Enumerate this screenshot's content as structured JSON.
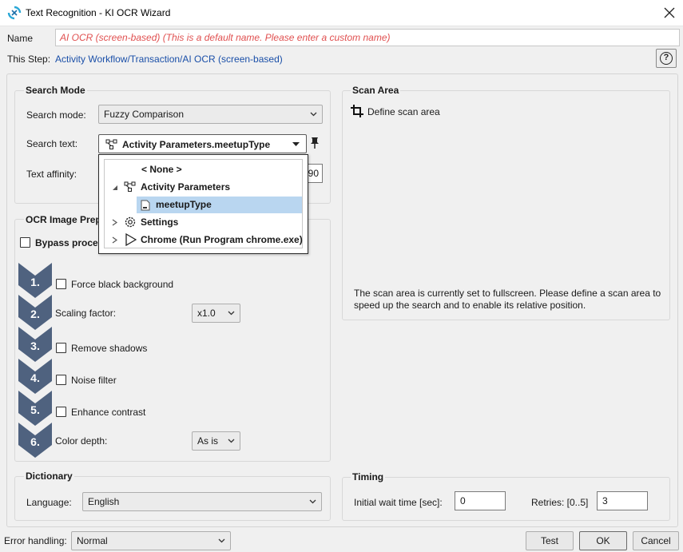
{
  "window": {
    "title": "Text Recognition - KI OCR Wizard"
  },
  "name_row": {
    "label": "Name",
    "placeholder": "AI OCR (screen-based)  (This is a default name. Please enter a custom name)"
  },
  "step_row": {
    "label": "This Step:",
    "path": "Activity Workflow/Transaction/AI OCR (screen-based)",
    "help_label": "?"
  },
  "search_mode": {
    "title": "Search Mode",
    "mode_label": "Search mode:",
    "mode_value": "Fuzzy Comparison",
    "text_label": "Search text:",
    "text_value": "Activity Parameters.meetupType",
    "affinity_label": "Text affinity:",
    "affinity_value": "90"
  },
  "dropdown": {
    "items": [
      {
        "label": "< None >"
      },
      {
        "label": "Activity Parameters"
      },
      {
        "label": "meetupType"
      },
      {
        "label": "Settings"
      },
      {
        "label": "Chrome (Run Program chrome.exe)"
      }
    ]
  },
  "ocr_prep": {
    "title": "OCR Image Prep",
    "bypass_label": "Bypass process",
    "steps": [
      {
        "num": "1.",
        "label": "Force black background"
      },
      {
        "num": "2.",
        "label": "Scaling factor:",
        "value": "x1.0"
      },
      {
        "num": "3.",
        "label": "Remove shadows"
      },
      {
        "num": "4.",
        "label": "Noise filter"
      },
      {
        "num": "5.",
        "label": "Enhance contrast"
      },
      {
        "num": "6.",
        "label": "Color depth:",
        "value": "As is"
      }
    ]
  },
  "scan_area": {
    "title": "Scan Area",
    "define_label": "Define scan area",
    "info": "The scan area is currently set to fullscreen. Please define a scan area to speed up the search and to enable its relative position."
  },
  "dictionary": {
    "title": "Dictionary",
    "language_label": "Language:",
    "language_value": "English"
  },
  "timing": {
    "title": "Timing",
    "wait_label": "Initial wait time [sec]:",
    "wait_value": "0",
    "retries_label": "Retries: [0..5]",
    "retries_value": "3"
  },
  "footer": {
    "error_label": "Error handling:",
    "error_value": "Normal",
    "test_label": "Test",
    "ok_label": "OK",
    "cancel_label": "Cancel"
  },
  "colors": {
    "accent": "#1a4fa8",
    "placeholder": "#e05050",
    "step_badge": "#4f627f",
    "selection": "#b9d6f0"
  }
}
